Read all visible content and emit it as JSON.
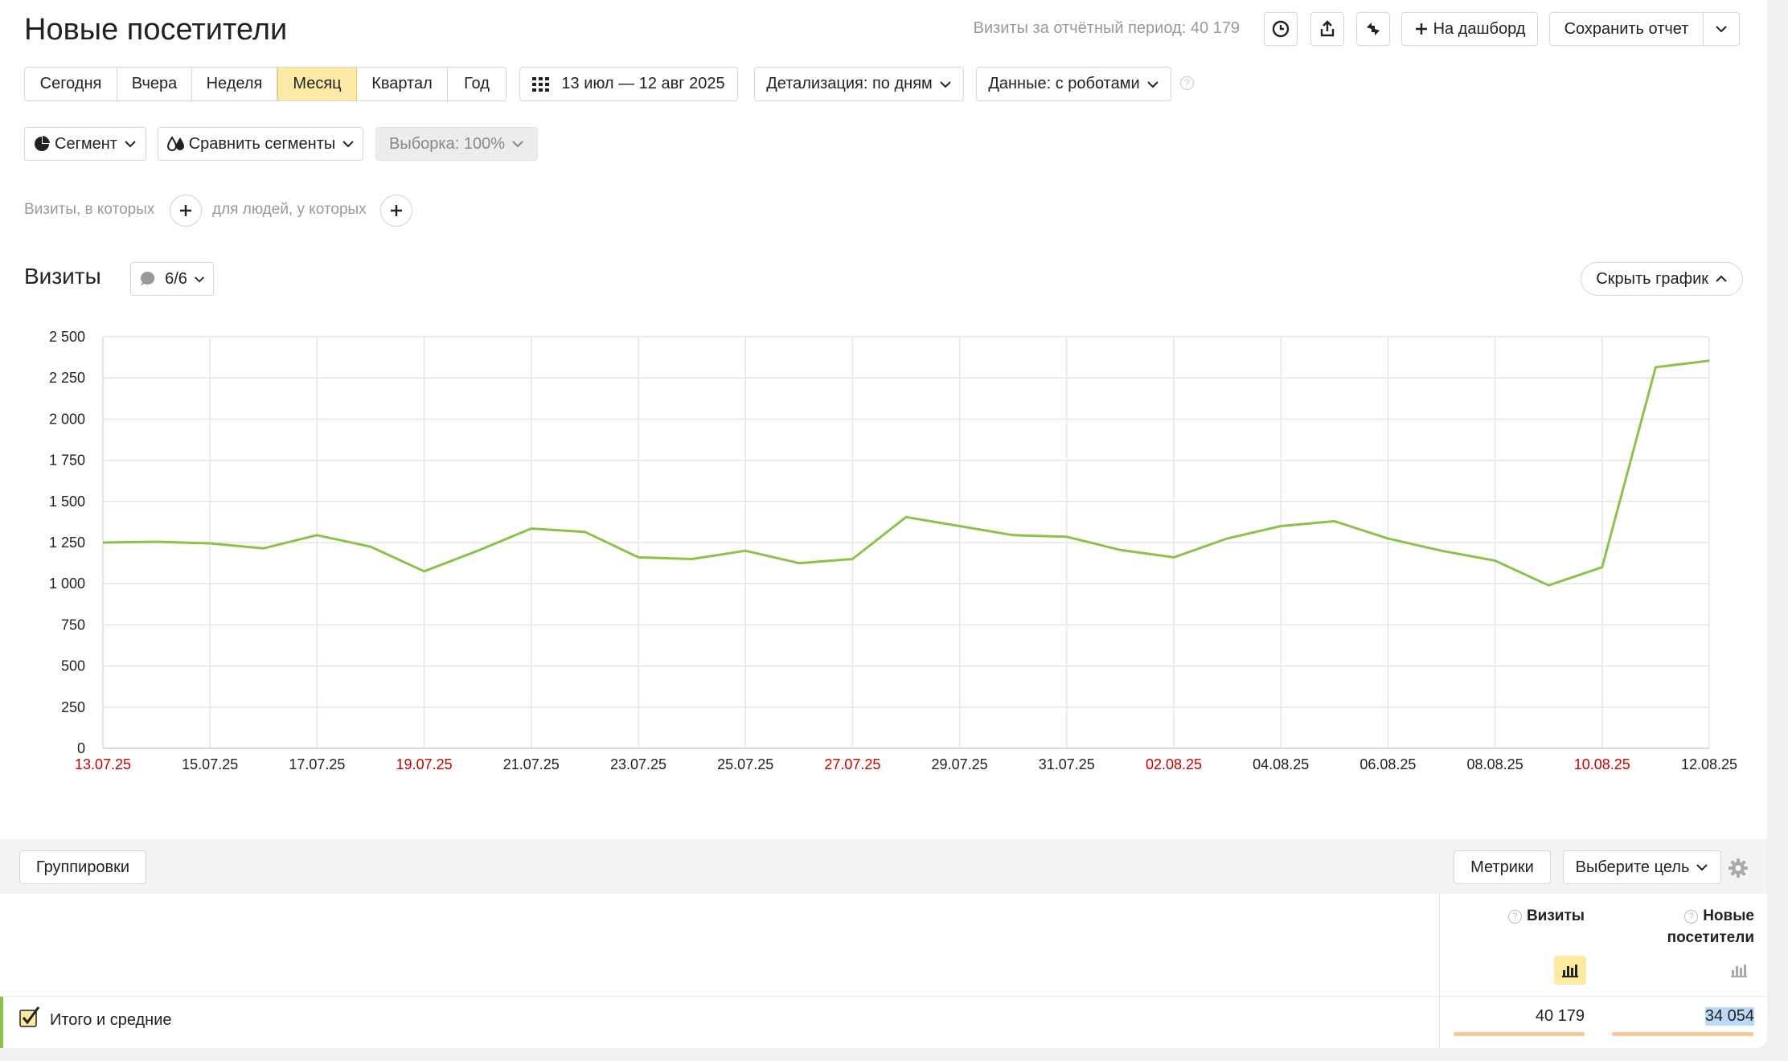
{
  "header": {
    "title": "Новые посетители",
    "period_summary": "Визиты за отчётный период: 40 179",
    "add_to_dashboard": "На дашборд",
    "save_report": "Сохранить отчет"
  },
  "period_tabs": [
    "Сегодня",
    "Вчера",
    "Неделя",
    "Месяц",
    "Квартал",
    "Год"
  ],
  "period_active": "Месяц",
  "date_range": "13 июл — 12 авг 2025",
  "detail": "Детализация: по дням",
  "data_source": "Данные: с роботами",
  "segment": {
    "segment_label": "Сегмент",
    "compare_label": "Сравнить сегменты",
    "sample_label": "Выборка: 100%"
  },
  "filters": {
    "visits_label": "Визиты, в которых",
    "people_label": "для людей, у которых"
  },
  "chart_section": {
    "title": "Визиты",
    "notes_count": "6/6",
    "hide_label": "Скрыть график"
  },
  "colors": {
    "line": "#8bc34a",
    "weekend_tick": "#cc0000",
    "active_tab": "#fdeaa6"
  },
  "chart_data": {
    "type": "line",
    "title": "",
    "xlabel": "",
    "ylabel": "",
    "ylim": [
      0,
      2500
    ],
    "yticks": [
      0,
      250,
      500,
      750,
      1000,
      1250,
      1500,
      1750,
      2000,
      2250,
      2500
    ],
    "ytick_labels": [
      "0",
      "250",
      "500",
      "750",
      "1 000",
      "1 250",
      "1 500",
      "1 750",
      "2 000",
      "2 250",
      "2 500"
    ],
    "x_tick_labels": [
      "13.07.25",
      "15.07.25",
      "17.07.25",
      "19.07.25",
      "21.07.25",
      "23.07.25",
      "25.07.25",
      "27.07.25",
      "29.07.25",
      "31.07.25",
      "02.08.25",
      "04.08.25",
      "06.08.25",
      "08.08.25",
      "10.08.25",
      "12.08.25"
    ],
    "x_tick_weekend": [
      true,
      false,
      false,
      true,
      false,
      false,
      false,
      true,
      false,
      false,
      true,
      false,
      false,
      false,
      true,
      false
    ],
    "grid": true,
    "series": [
      {
        "values": [
          1250,
          1255,
          1245,
          1215,
          1295,
          1225,
          1075,
          1200,
          1335,
          1315,
          1160,
          1150,
          1200,
          1125,
          1150,
          1405,
          1350,
          1295,
          1285,
          1205,
          1160,
          1275,
          1350,
          1380,
          1275,
          1200,
          1140,
          990,
          1100,
          2315,
          2355
        ]
      }
    ]
  },
  "table": {
    "groupings_label": "Группировки",
    "metrics_label": "Метрики",
    "goal_label": "Выберите цель",
    "col_visits": "Визиты",
    "col_new_visitors_line1": "Новые",
    "col_new_visitors_line2": "посетители",
    "total_label": "Итого и средние",
    "total_visits": "40 179",
    "total_new_visitors": "34 054"
  }
}
